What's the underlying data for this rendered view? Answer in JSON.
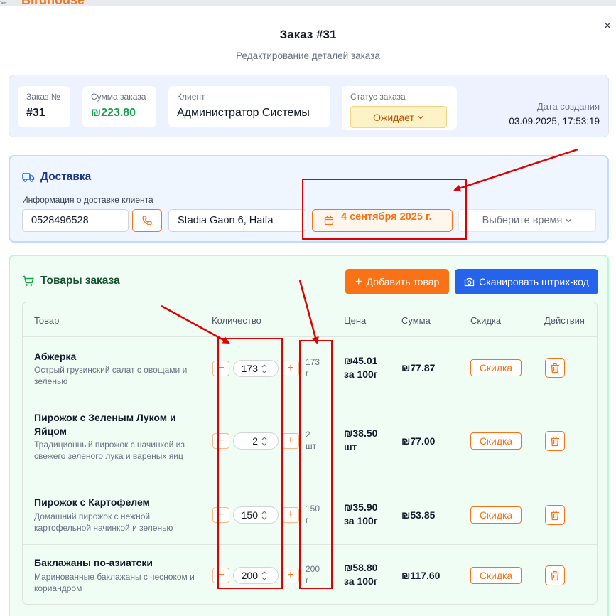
{
  "topbar": {
    "brand": "Birdhouse",
    "tiny_text": "Tasty"
  },
  "modal": {
    "title": "Заказ #31",
    "subtitle": "Редактирование деталей заказа",
    "close": "×"
  },
  "order_info": {
    "order_no_label": "Заказ №",
    "order_no": "#31",
    "sum_label": "Сумма заказа",
    "sum": "₪223.80",
    "client_label": "Клиент",
    "client": "Администратор Системы",
    "status_label": "Статус заказа",
    "status": "Ожидает",
    "created_label": "Дата создания",
    "created": "03.09.2025, 17:53:19"
  },
  "delivery": {
    "title": "Доставка",
    "info_label": "Информация о доставке клиента",
    "phone": "0528496528",
    "address": "Stadia Gaon 6, Haifa",
    "date": "4 сентября 2025 г.",
    "time_placeholder": "Выберите время"
  },
  "items": {
    "title": "Товары заказа",
    "add_button": "Добавить товар",
    "scan_button": "Сканировать штрих-код",
    "headers": [
      "Товар",
      "Количество",
      "Цена",
      "Сумма",
      "Скидка",
      "Действия"
    ],
    "rows": [
      {
        "name": "Абжерка",
        "desc": "Острый грузинский салат с овощами и зеленью",
        "qty": "173",
        "unit_qty": "173",
        "unit": "г",
        "price": "₪45.01",
        "price_per": "за 100г",
        "sum": "₪77.87",
        "discount": "Скидка"
      },
      {
        "name": "Пирожок с Зеленым Луком и Яйцом",
        "desc": "Традиционный пирожок с начинкой из свежего зеленого лука и вареных яиц",
        "qty": "2",
        "unit_qty": "2",
        "unit": "шт",
        "price": "₪38.50",
        "price_per": "шт",
        "sum": "₪77.00",
        "discount": "Скидка"
      },
      {
        "name": "Пирожок с Картофелем",
        "desc": "Домашний пирожок с нежной картофельной начинкой и зеленью",
        "qty": "150",
        "unit_qty": "150",
        "unit": "г",
        "price": "₪35.90",
        "price_per": "за 100г",
        "sum": "₪53.85",
        "discount": "Скидка"
      },
      {
        "name": "Баклажаны по-азиатски",
        "desc": "Маринованные баклажаны с чесноком и кориандром",
        "qty": "200",
        "unit_qty": "200",
        "unit": "г",
        "price": "₪58.80",
        "price_per": "за 100г",
        "sum": "₪117.60",
        "discount": "Скидка"
      }
    ]
  },
  "colors": {
    "accent": "#f97316",
    "primary": "#2563eb",
    "success": "#16a34a",
    "annotation": "#e00000"
  }
}
